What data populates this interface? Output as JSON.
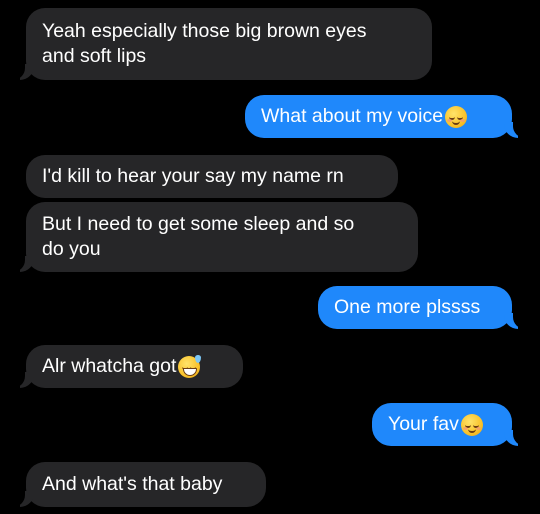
{
  "messages": [
    {
      "direction": "received",
      "lines": [
        "Yeah especially those big brown eyes",
        "and soft lips"
      ]
    },
    {
      "direction": "sent",
      "text": "What about my voice",
      "emoji": "relieved-face"
    },
    {
      "direction": "received",
      "text": "I'd kill to hear your say my name rn"
    },
    {
      "direction": "received",
      "lines": [
        "But I need to get some sleep and so",
        "do you"
      ]
    },
    {
      "direction": "sent",
      "text": "One more plssss"
    },
    {
      "direction": "received",
      "text": "Alr whatcha got",
      "emoji": "grinning-sweat-face"
    },
    {
      "direction": "sent",
      "text": "Your fav",
      "emoji": "smiling-blush-face"
    },
    {
      "direction": "received",
      "text": "And what's that baby"
    }
  ],
  "colors": {
    "background": "#000000",
    "sent_bubble": "#1f88fb",
    "received_bubble": "#262628",
    "text": "#ffffff"
  }
}
